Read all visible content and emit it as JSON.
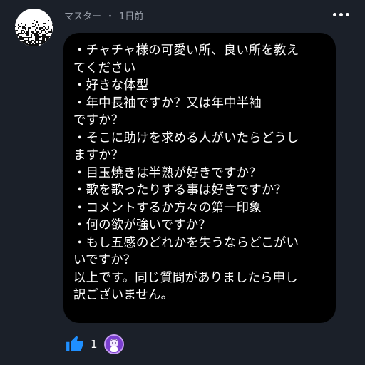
{
  "post": {
    "author": "マスター",
    "separator": "・",
    "time": "1日前",
    "more_icon": "more-horizontal-icon",
    "avatar_icon": "avatar-static-noise"
  },
  "message": {
    "lines": [
      "・チャチャ様の可愛い所、良い所を教え",
      "てください",
      "・好きな体型",
      "・年中長袖ですか？又は年中半袖",
      "ですか？",
      "・そこに助けを求める人がいたらどうし",
      "ますか？",
      "・目玉焼きは半熟が好きですか？",
      "・歌を歌ったりする事は好きですか？",
      "・コメントするか方々の第一印象",
      "・何の欲が強いですか？",
      "・もし五感のどれかを失うならどこがい",
      "いですか？",
      "以上です。同じ質問がありましたら申し",
      "訳ございません。"
    ]
  },
  "reactions": {
    "like_icon": "thumbs-up-icon",
    "like_count": "1",
    "reactor_icon": "reactor-avatar"
  },
  "colors": {
    "background": "#1b2029",
    "bubble": "#000000",
    "like": "#1f8fff",
    "reactor": "#7b3fd0"
  }
}
